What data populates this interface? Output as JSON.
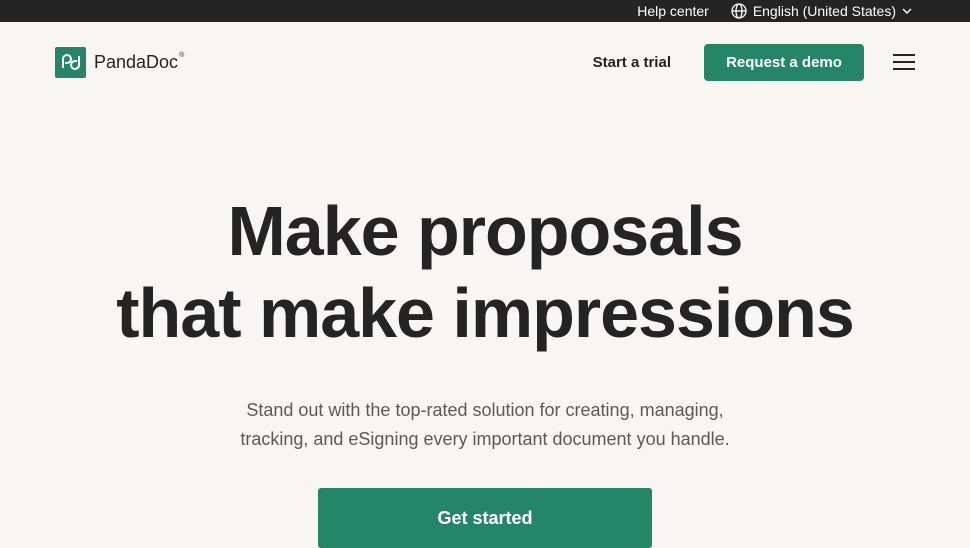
{
  "topbar": {
    "help_label": "Help center",
    "language_label": "English (United States)",
    "language_icon": "globe-icon",
    "caret_icon": "chevron-down-icon"
  },
  "header": {
    "brand_name": "PandaDoc",
    "brand_mark": "®",
    "trial_label": "Start a trial",
    "demo_label": "Request a demo",
    "menu_icon": "hamburger-menu-icon"
  },
  "hero": {
    "headline_line1": "Make proposals",
    "headline_line2": "that make impressions",
    "subtext_line1": "Stand out with the top-rated solution for creating, managing,",
    "subtext_line2": "tracking, and eSigning every important document you handle.",
    "cta_label": "Get started"
  },
  "colors": {
    "brand_green": "#248567",
    "background": "#f8f5f2",
    "topbar": "#242424",
    "text": "#242424"
  }
}
